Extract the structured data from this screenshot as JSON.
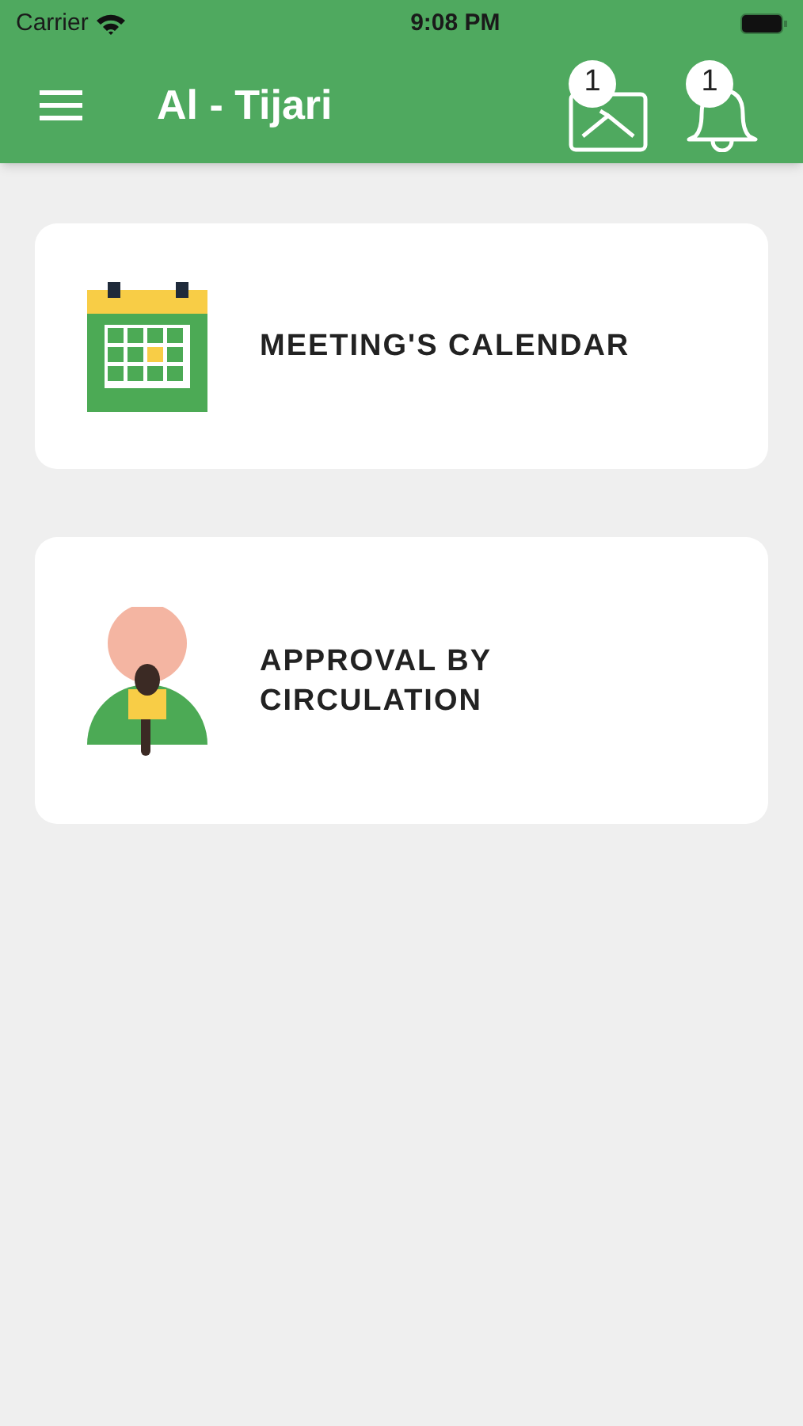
{
  "status_bar": {
    "carrier": "Carrier",
    "time": "9:08 PM"
  },
  "app_bar": {
    "title": "Al - Tijari",
    "mail_badge": "1",
    "notification_badge": "1"
  },
  "cards": [
    {
      "kind": "calendar",
      "label": "MEETING'S CALENDAR"
    },
    {
      "kind": "approval",
      "label": "APPROVAL BY CIRCULATION"
    }
  ]
}
